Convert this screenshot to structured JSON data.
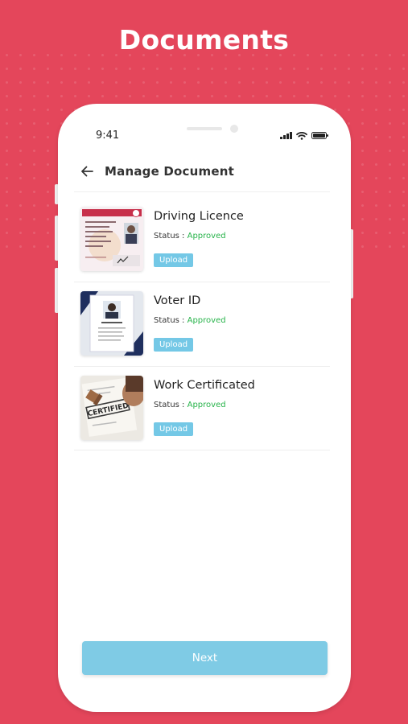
{
  "header": {
    "title": "Documents"
  },
  "status_bar": {
    "time": "9:41"
  },
  "topbar": {
    "title": "Manage Document",
    "back_icon": "arrow-left-icon"
  },
  "documents": [
    {
      "title": "Driving Licence",
      "status_label": "Status :",
      "status_value": "Approved",
      "action_label": "Upload",
      "thumb_icon": "driving-licence-thumbnail"
    },
    {
      "title": "Voter ID",
      "status_label": "Status :",
      "status_value": "Approved",
      "action_label": "Upload",
      "thumb_icon": "voter-id-thumbnail"
    },
    {
      "title": "Work Certificated",
      "status_label": "Status :",
      "status_value": "Approved",
      "action_label": "Upload",
      "thumb_icon": "certificate-thumbnail"
    }
  ],
  "thumbnail_text": {
    "certificate_stamp": "CERTIFIED"
  },
  "footer": {
    "next_label": "Next"
  },
  "colors": {
    "background": "#e4465b",
    "approved": "#27b34a",
    "accent": "#74c8e6",
    "next_button": "#7fcbe5"
  }
}
